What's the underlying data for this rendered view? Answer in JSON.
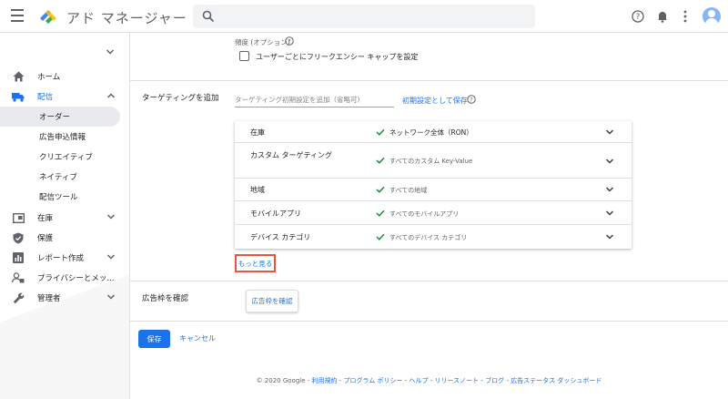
{
  "app": {
    "title": "アド マネージャー",
    "logo_colors": [
      "#4285f4",
      "#34a853",
      "#fbbc04"
    ]
  },
  "search": {
    "placeholder": "",
    "value": ""
  },
  "sidebar": {
    "items": [
      {
        "label": "ホーム",
        "icon": "home-icon"
      },
      {
        "label": "配信",
        "icon": "truck-icon",
        "expanded": true
      },
      {
        "label": "オーダー",
        "sub": true,
        "selected": true
      },
      {
        "label": "広告申込情報",
        "sub": true
      },
      {
        "label": "クリエイティブ",
        "sub": true
      },
      {
        "label": "ネイティブ",
        "sub": true
      },
      {
        "label": "配信ツール",
        "sub": true
      },
      {
        "label": "在庫",
        "icon": "inventory-icon"
      },
      {
        "label": "保護",
        "icon": "shield-icon"
      },
      {
        "label": "レポート作成",
        "icon": "report-icon"
      },
      {
        "label": "プライバシーとメッ...",
        "icon": "privacy-icon"
      },
      {
        "label": "管理者",
        "icon": "wrench-icon"
      }
    ]
  },
  "frequency": {
    "label": "頻度 (オプション)",
    "checkbox_label": "ユーザーごとにフリークエンシー キャップを設定",
    "checked": false
  },
  "targeting": {
    "title": "ターゲティングを追加",
    "input_placeholder": "ターゲティング初期設定を追加（省略可）",
    "save_default": "初期設定として保存",
    "rows": [
      {
        "name": "在庫",
        "value": "ネットワーク全体（RON）",
        "emphasis": true
      },
      {
        "name": "カスタム ターゲティング",
        "value": "すべてのカスタム Key-Value"
      },
      {
        "name": "地域",
        "value": "すべての地域"
      },
      {
        "name": "モバイルアプリ",
        "value": "すべてのモバイルアプリ"
      },
      {
        "name": "デバイス カテゴリ",
        "value": "すべてのデバイス カテゴリ"
      }
    ],
    "more_link": "もっと見る"
  },
  "inventory_check": {
    "title": "広告枠を確認",
    "button": "広告枠を確認"
  },
  "actions": {
    "save": "保存",
    "cancel": "キャンセル"
  },
  "footer": {
    "copyright": "© 2020 Google",
    "links": [
      "利用規約",
      "プログラム ポリシー",
      "ヘルプ",
      "リリースノート",
      "ブログ",
      "広告ステータス ダッシュボード"
    ]
  },
  "colors": {
    "accent": "#1a73e8",
    "check": "#1e8e3e",
    "highlight": "#e8553e"
  }
}
